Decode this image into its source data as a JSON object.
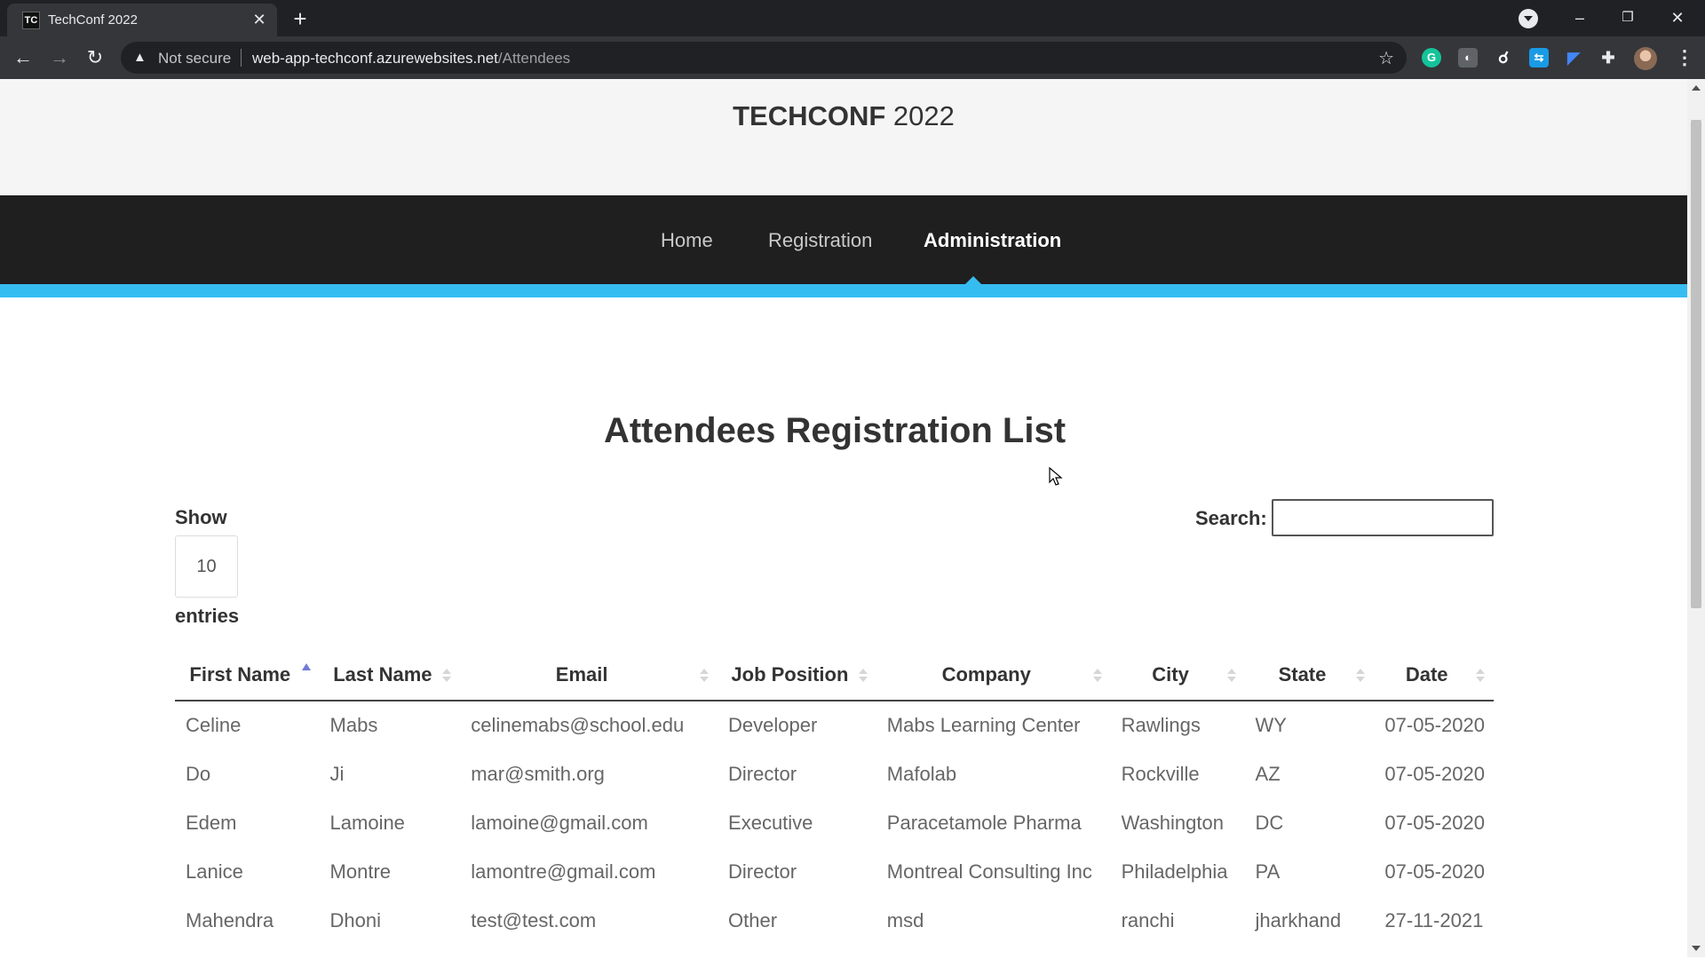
{
  "browser": {
    "tab_title": "TechConf 2022",
    "favicon_text": "TC",
    "security_text": "Not secure",
    "url_host": "web-app-techconf.azurewebsites.net",
    "url_path": "/Attendees",
    "icons": [
      "back-arrow-icon",
      "forward-arrow-icon",
      "reload-icon",
      "warning-triangle-icon",
      "star-icon",
      "extensions-puzzle-icon",
      "kebab-menu-icon"
    ]
  },
  "site": {
    "brand_strong": "TECHCONF",
    "brand_light": " 2022",
    "nav": [
      {
        "label": "Home",
        "active": false
      },
      {
        "label": "Registration",
        "active": false
      },
      {
        "label": "Administration",
        "active": true
      }
    ],
    "accent_color": "#35bdf2"
  },
  "page": {
    "title": "Attendees Registration List",
    "show_label": "Show",
    "entries_value": "10",
    "entries_label": "entries",
    "search_label": "Search:",
    "search_value": ""
  },
  "table": {
    "columns": [
      "First Name",
      "Last Name",
      "Email",
      "Job Position",
      "Company",
      "City",
      "State",
      "Date"
    ],
    "sorted_column": "First Name",
    "rows": [
      [
        "Celine",
        "Mabs",
        "celinemabs@school.edu",
        "Developer",
        "Mabs Learning Center",
        "Rawlings",
        "WY",
        "07-05-2020"
      ],
      [
        "Do",
        "Ji",
        "mar@smith.org",
        "Director",
        "Mafolab",
        "Rockville",
        "AZ",
        "07-05-2020"
      ],
      [
        "Edem",
        "Lamoine",
        "lamoine@gmail.com",
        "Executive",
        "Paracetamole Pharma",
        "Washington",
        "DC",
        "07-05-2020"
      ],
      [
        "Lanice",
        "Montre",
        "lamontre@gmail.com",
        "Director",
        "Montreal Consulting Inc",
        "Philadelphia",
        "PA",
        "07-05-2020"
      ],
      [
        "Mahendra",
        "Dhoni",
        "test@test.com",
        "Other",
        "msd",
        "ranchi",
        "jharkhand",
        "27-11-2021"
      ]
    ]
  }
}
